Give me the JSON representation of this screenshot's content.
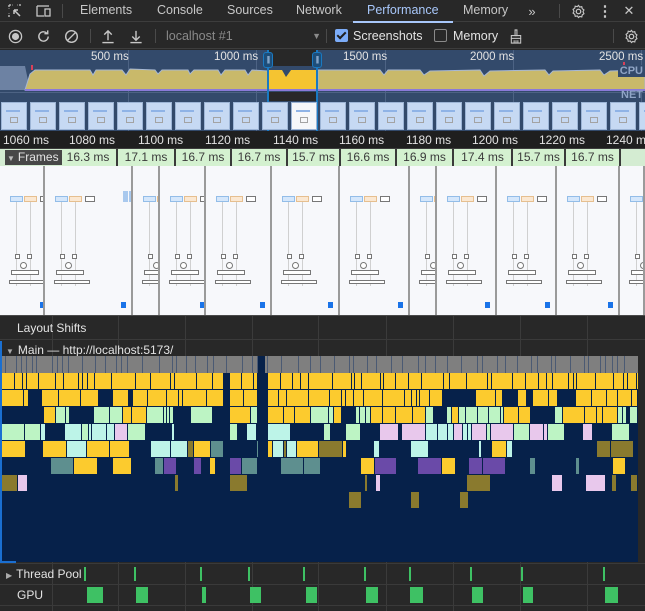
{
  "tabbar": {
    "tabs": [
      {
        "label": "Elements",
        "active": false
      },
      {
        "label": "Console",
        "active": false
      },
      {
        "label": "Sources",
        "active": false
      },
      {
        "label": "Network",
        "active": false
      },
      {
        "label": "Performance",
        "active": true
      },
      {
        "label": "Memory",
        "active": false
      }
    ],
    "more_tabs_icon": "»",
    "settings_icon": "⚙",
    "kebab_icon": "⋮",
    "close_icon": "✕",
    "inspect_icon": "⬚",
    "device_icon": "▭"
  },
  "toolbar": {
    "record_icon": "◉",
    "reload_icon": "↻",
    "clear_icon": "⊘",
    "upload_icon": "⤒",
    "download_icon": "⤓",
    "target": "localhost #1",
    "screenshots_label": "Screenshots",
    "screenshots_checked": true,
    "memory_label": "Memory",
    "memory_checked": false,
    "gc_icon": "🧹",
    "capture_settings_icon": "⚙"
  },
  "overview": {
    "ticks": [
      "500 ms",
      "1000 ms",
      "1500 ms",
      "2000 ms",
      "2500 ms"
    ],
    "cpu_label": "CPU",
    "net_label": "NET",
    "selection_range_ms": [
      1060,
      1250
    ],
    "colors": {
      "scripting": "#c9b96a",
      "scripting_selected": "#f5c431",
      "bg": "#334a6b"
    }
  },
  "ruler": {
    "labels": [
      "1060 ms",
      "1080 ms",
      "1100 ms",
      "1120 ms",
      "1140 ms",
      "1160 ms",
      "1180 ms",
      "1200 ms",
      "1220 ms",
      "1240 ms"
    ]
  },
  "frames": {
    "label": "Frames",
    "durations": [
      "16.3 ms",
      "17.1 ms",
      "16.7 ms",
      "16.7 ms",
      "15.7 ms",
      "16.6 ms",
      "16.9 ms",
      "17.4 ms",
      "15.7 ms",
      "16.7 ms"
    ]
  },
  "tracks": {
    "layout_shifts": "Layout Shifts",
    "main": "Main — http://localhost:5173/",
    "thread_pool": "Thread Pool",
    "gpu": "GPU"
  },
  "colors": {
    "task": "#7f7f7f",
    "scripting": "#fccb2e",
    "scripting_dark": "#8a7a2e",
    "function_green": "#bdf4c4",
    "function_cyan": "#bdf4e8",
    "pink": "#e8c8ec",
    "purple": "#6a4aa8",
    "teal": "#5e8f8f",
    "main_bg": "#06214a",
    "gpu": "#3ec164"
  }
}
